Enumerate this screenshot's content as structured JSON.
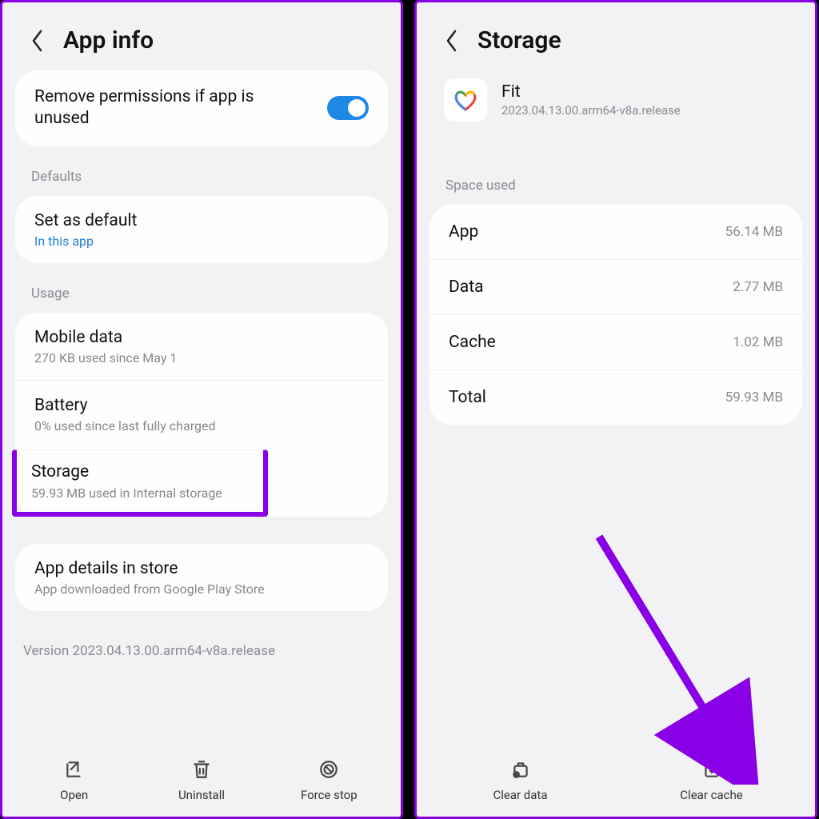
{
  "left": {
    "title": "App info",
    "permission_toggle": "Remove permissions if app is unused",
    "sections": {
      "defaults_label": "Defaults",
      "set_default": {
        "title": "Set as default",
        "sub": "In this app"
      },
      "usage_label": "Usage",
      "mobile_data": {
        "title": "Mobile data",
        "sub": "270 KB used since May 1"
      },
      "battery": {
        "title": "Battery",
        "sub": "0% used since last fully charged"
      },
      "storage": {
        "title": "Storage",
        "sub": "59.93 MB used in Internal storage"
      },
      "app_details": {
        "title": "App details in store",
        "sub": "App downloaded from Google Play Store"
      }
    },
    "version": "Version 2023.04.13.00.arm64-v8a.release",
    "bottom": {
      "open": "Open",
      "uninstall": "Uninstall",
      "force_stop": "Force stop"
    }
  },
  "right": {
    "title": "Storage",
    "app": {
      "name": "Fit",
      "version": "2023.04.13.00.arm64-v8a.release"
    },
    "space_used_label": "Space used",
    "rows": {
      "app": {
        "label": "App",
        "val": "56.14 MB"
      },
      "data": {
        "label": "Data",
        "val": "2.77 MB"
      },
      "cache": {
        "label": "Cache",
        "val": "1.02 MB"
      },
      "total": {
        "label": "Total",
        "val": "59.93 MB"
      }
    },
    "bottom": {
      "clear_data": "Clear data",
      "clear_cache": "Clear cache"
    }
  }
}
